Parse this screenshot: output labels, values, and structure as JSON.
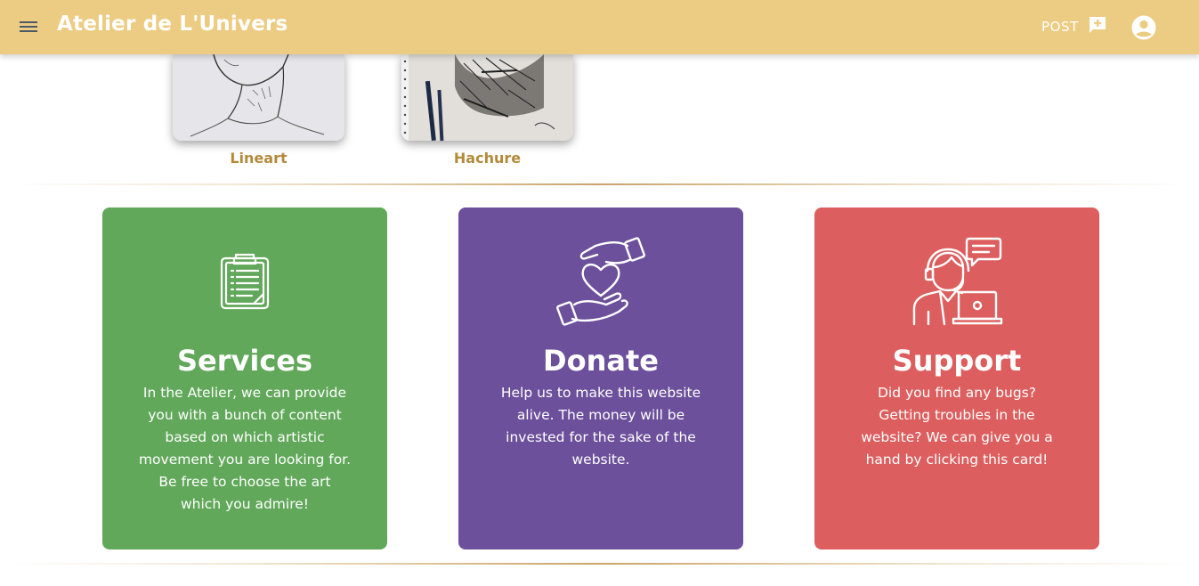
{
  "appbar": {
    "title": "Atelier de L'Univers",
    "post_label": "POST",
    "menu_icon": "menu-icon",
    "post_icon": "add-comment-icon",
    "account_icon": "account-circle-icon"
  },
  "gallery": {
    "items": [
      {
        "label": "Lineart",
        "image": "lineart-sketch-image"
      },
      {
        "label": "Hachure",
        "image": "hachure-sketch-image"
      }
    ]
  },
  "cards": [
    {
      "title": "Services",
      "text": "In the Atelier, we can provide you with a bunch of content based on which artistic movement you are looking for. Be free to choose the art which you admire!",
      "icon": "clipboard-icon",
      "color": "#61a85a"
    },
    {
      "title": "Donate",
      "text": "Help us to make this website alive. The money will be invested for the sake of the website.",
      "icon": "hands-heart-icon",
      "color": "#6c509b"
    },
    {
      "title": "Support",
      "text": "Did you find any bugs? Getting troubles in the website? We can give you a hand by clicking this card!",
      "icon": "support-agent-icon",
      "color": "#dd5e5e"
    }
  ],
  "colors": {
    "appbar": "#eccc83",
    "caption": "#b38a3a"
  }
}
